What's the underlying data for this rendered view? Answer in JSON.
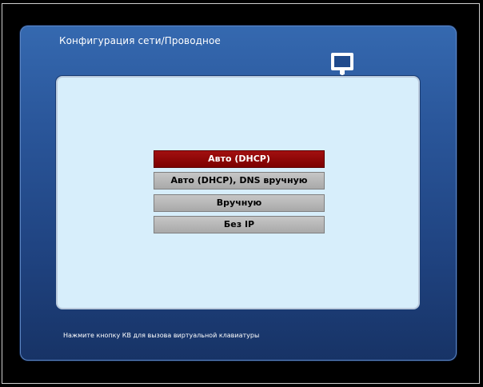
{
  "panel": {
    "title": "Конфигурация сети/Проводное",
    "icon": "network-icon"
  },
  "options": [
    {
      "label": "Авто (DHCP)",
      "selected": true
    },
    {
      "label": "Авто (DHCP), DNS вручную",
      "selected": false
    },
    {
      "label": "Вручную",
      "selected": false
    },
    {
      "label": "Без IP",
      "selected": false
    }
  ],
  "footer": {
    "hint": "Нажмите кнопку КВ для вызова виртуальной клавиатуры"
  },
  "colors": {
    "selected": "#8b0000",
    "option": "#b8b8b8",
    "panel": "#2a569a",
    "content": "#d7eefb"
  }
}
